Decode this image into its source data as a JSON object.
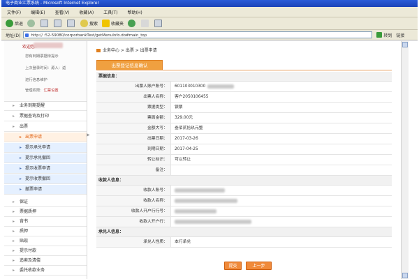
{
  "browser": {
    "title": "电子商业汇票系统 - Microsoft Internet Explorer",
    "menu": [
      "文件(F)",
      "编辑(E)",
      "查看(V)",
      "收藏(A)",
      "工具(T)",
      "帮助(H)"
    ],
    "toolbar": {
      "back": "后退",
      "search": "搜索",
      "favorites": "收藏夹"
    },
    "address_label": "地址(D)",
    "address": "http://          :52-59080/corporbankTest/getMenuInfo.do#main_top",
    "go": "转到",
    "links": "链接"
  },
  "sidebar": {
    "user_prefix": "欢迎您：",
    "user_lines": [
      "您有到期票据待提示",
      "上次登录时间：源入：返",
      "进行信息维护",
      "管理权限："
    ],
    "user_role": "汇票设置",
    "items": [
      {
        "label": "业务到期提醒",
        "type": "main"
      },
      {
        "label": "票据查询及打印",
        "type": "main"
      },
      {
        "label": "出票",
        "type": "main"
      },
      {
        "label": "出票申请",
        "type": "sub-active"
      },
      {
        "label": "提示承兑申请",
        "type": "sub"
      },
      {
        "label": "提示承兑撤回",
        "type": "sub"
      },
      {
        "label": "提示收票申请",
        "type": "sub"
      },
      {
        "label": "提示收票撤回",
        "type": "sub"
      },
      {
        "label": "撤票申请",
        "type": "sub"
      },
      {
        "label": "保证",
        "type": "main"
      },
      {
        "label": "票据质押",
        "type": "main"
      },
      {
        "label": "背书",
        "type": "main"
      },
      {
        "label": "质押",
        "type": "main"
      },
      {
        "label": "贴现",
        "type": "main"
      },
      {
        "label": "提示付款",
        "type": "main"
      },
      {
        "label": "追索及清偿",
        "type": "main"
      },
      {
        "label": "委托收款业务",
        "type": "main"
      }
    ]
  },
  "main": {
    "breadcrumb": "业务中心 > 出票 > 出票申请",
    "panel_title": "出票登记信息确认",
    "sections": {
      "bill": "票据信息：",
      "payee": "收款人信息：",
      "acceptor": "承兑人信息："
    },
    "bill_fields": [
      {
        "label": "出票人账户账号：",
        "value": "601103010300"
      },
      {
        "label": "出票人名称：",
        "value": "客户2050106455"
      },
      {
        "label": "票据类型：",
        "value": "银票"
      },
      {
        "label": "票面金额：",
        "value": "329.00元"
      },
      {
        "label": "金额大写：",
        "value": "叁佰贰拾玖元整"
      },
      {
        "label": "出票日期：",
        "value": "2017-03-26"
      },
      {
        "label": "到期日期：",
        "value": "2017-04-25"
      },
      {
        "label": "转让标识：",
        "value": "可以转让"
      },
      {
        "label": "备注：",
        "value": ""
      }
    ],
    "payee_fields": [
      {
        "label": "收款人账号："
      },
      {
        "label": "收款人名称："
      },
      {
        "label": "收款人开户行行号："
      },
      {
        "label": "收款人开户行："
      }
    ],
    "acceptor_fields": [
      {
        "label": "承兑人性质：",
        "value": "本行承兑"
      }
    ],
    "buttons": {
      "submit": "提交",
      "prev": "上一步"
    }
  },
  "colors": {
    "accent": "#f08a3a",
    "title_blue": "#1b43b8",
    "sub_nav": "#e5f0ff"
  }
}
